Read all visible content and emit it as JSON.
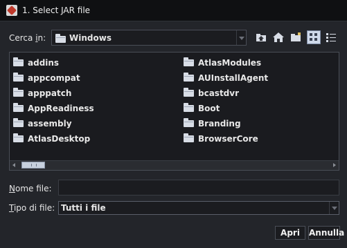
{
  "window": {
    "title": "1. Select JAR file"
  },
  "look_in": {
    "label_prefix": "Cerca ",
    "label_mnemonic": "i",
    "label_suffix": "n:",
    "value": "Windows"
  },
  "toolbar": {
    "buttons": [
      {
        "name": "up-one-level-icon"
      },
      {
        "name": "home-icon"
      },
      {
        "name": "new-folder-icon"
      },
      {
        "name": "list-view-icon",
        "selected": true
      },
      {
        "name": "details-view-icon",
        "selected": false
      }
    ]
  },
  "files": {
    "left": [
      "addins",
      "appcompat",
      "apppatch",
      "AppReadiness",
      "assembly",
      "AtlasDesktop"
    ],
    "right": [
      "AtlasModules",
      "AUInstallAgent",
      "bcastdvr",
      "Boot",
      "Branding",
      "BrowserCore"
    ]
  },
  "file_name": {
    "label_mnemonic": "N",
    "label_rest": "ome file:",
    "value": ""
  },
  "file_type": {
    "label_mnemonic": "T",
    "label_rest": "ipo di file:",
    "value": "Tutti i file"
  },
  "buttons": {
    "open": "Apri",
    "cancel": "Annulla"
  },
  "colors": {
    "background": "#23252a",
    "titlebar": "#0f1012",
    "list_bg": "#1a1b1f",
    "folder_icon": "#d8dde6"
  }
}
